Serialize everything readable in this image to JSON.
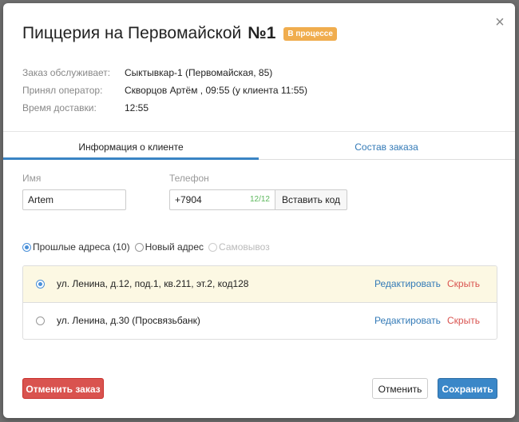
{
  "modal": {
    "title": "Пиццерия на Первомайской",
    "order_number": "№1",
    "status_badge": "В процессе",
    "close_icon": "×"
  },
  "info": [
    {
      "label": "Заказ обслуживает:",
      "value": "Сыктывкар-1 (Первомайская, 85)"
    },
    {
      "label": "Принял оператор:",
      "value": "Скворцов Артём , 09:55 (у клиента 11:55)"
    },
    {
      "label": "Время доставки:",
      "value": "12:55"
    }
  ],
  "tabs": [
    {
      "label": "Информация о клиенте",
      "active": true
    },
    {
      "label": "Состав заказа",
      "active": false
    }
  ],
  "form": {
    "name_label": "Имя",
    "name_value": "Artem",
    "phone_label": "Телефон",
    "phone_value": "+7904",
    "phone_counter": "12/12",
    "insert_code_button": "Вставить код"
  },
  "address_mode": {
    "options": [
      {
        "label": "Прошлые адреса (10)",
        "selected": true,
        "disabled": false
      },
      {
        "label": "Новый адрес",
        "selected": false,
        "disabled": false
      },
      {
        "label": "Самовывоз",
        "selected": false,
        "disabled": true
      }
    ]
  },
  "addresses": [
    {
      "text": "ул. Ленина, д.12, под.1, кв.211, эт.2, код128",
      "edit": "Редактировать",
      "hide": "Скрыть",
      "selected": true
    },
    {
      "text": "ул. Ленина, д.30 (Просвязьбанк)",
      "edit": "Редактировать",
      "hide": "Скрыть",
      "selected": false
    }
  ],
  "footer": {
    "cancel_order": "Отменить заказ",
    "cancel": "Отменить",
    "save": "Сохранить"
  },
  "colors": {
    "badge": "#f0ad4e",
    "primary": "#3a87c8",
    "danger": "#d9534f",
    "selected_row": "#fcf8e3",
    "link": "#337ab7"
  }
}
